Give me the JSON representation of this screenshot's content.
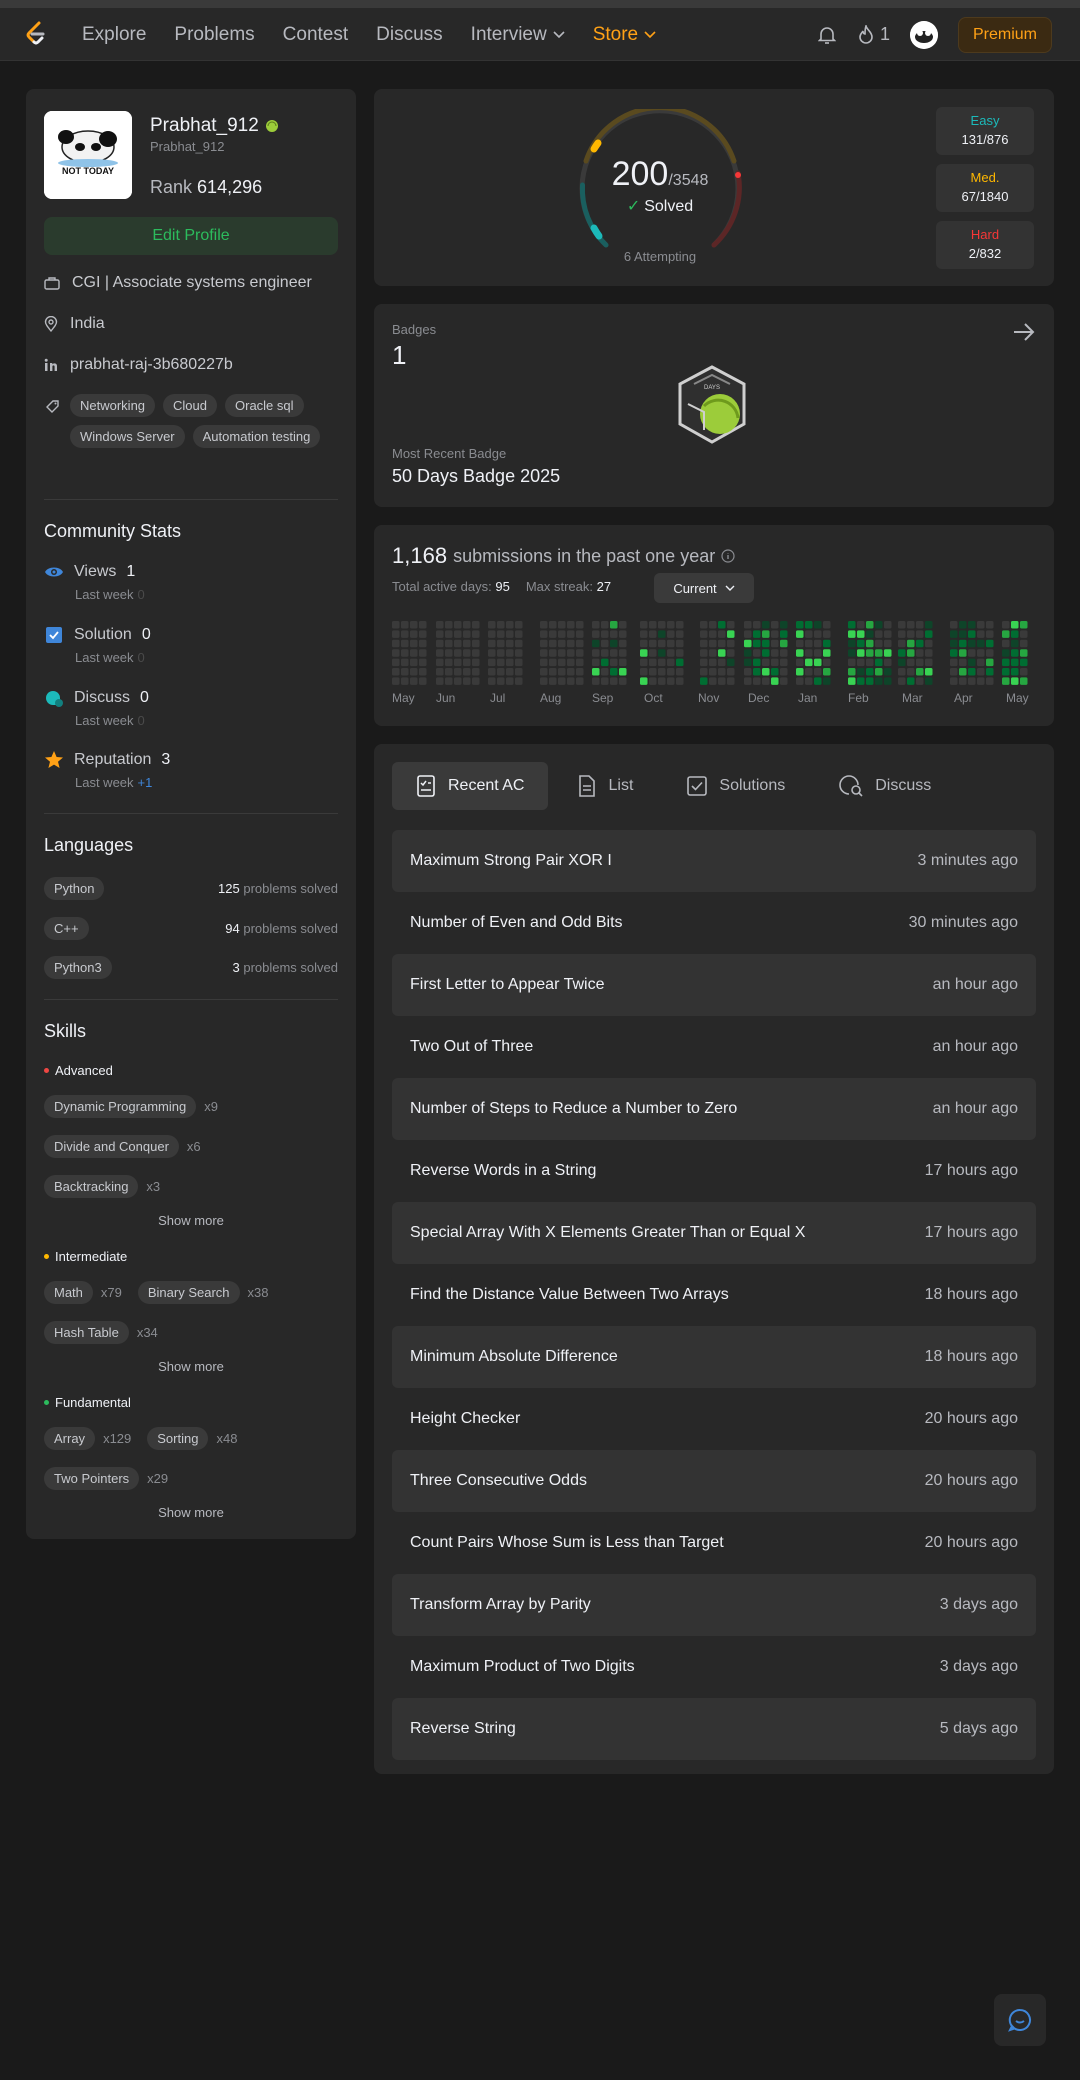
{
  "nav": {
    "links": [
      "Explore",
      "Problems",
      "Contest",
      "Discuss",
      "Interview",
      "Store"
    ],
    "streak": "1",
    "premium": "Premium"
  },
  "profile": {
    "name": "Prabhat_912",
    "username": "Prabhat_912",
    "rank_label": "Rank",
    "rank": "614,296",
    "avatar_text": "NOT TODAY",
    "edit": "Edit Profile",
    "company": "CGI | Associate systems engineer",
    "location": "India",
    "linkedin": "prabhat-raj-3b680227b",
    "tags": [
      "Networking",
      "Cloud",
      "Oracle sql",
      "Windows Server",
      "Automation testing"
    ]
  },
  "community": {
    "title": "Community Stats",
    "last_week": "Last week",
    "stats": [
      {
        "label": "Views",
        "value": "1",
        "delta": "0"
      },
      {
        "label": "Solution",
        "value": "0",
        "delta": "0"
      },
      {
        "label": "Discuss",
        "value": "0",
        "delta": "0"
      },
      {
        "label": "Reputation",
        "value": "3",
        "delta": "+1"
      }
    ]
  },
  "languages": {
    "title": "Languages",
    "suffix": "problems solved",
    "items": [
      {
        "name": "Python",
        "count": "125"
      },
      {
        "name": "C++",
        "count": "94"
      },
      {
        "name": "Python3",
        "count": "3"
      }
    ]
  },
  "skills": {
    "title": "Skills",
    "show_more": "Show more",
    "levels": [
      {
        "name": "Advanced",
        "color": "#ef4743",
        "items": [
          {
            "n": "Dynamic Programming",
            "c": "x9"
          },
          {
            "n": "Divide and Conquer",
            "c": "x6"
          },
          {
            "n": "Backtracking",
            "c": "x3"
          }
        ]
      },
      {
        "name": "Intermediate",
        "color": "#ffb800",
        "items": [
          {
            "n": "Math",
            "c": "x79"
          },
          {
            "n": "Binary Search",
            "c": "x38"
          },
          {
            "n": "Hash Table",
            "c": "x34"
          }
        ]
      },
      {
        "name": "Fundamental",
        "color": "#2cbb5d",
        "items": [
          {
            "n": "Array",
            "c": "x129"
          },
          {
            "n": "Sorting",
            "c": "x48"
          },
          {
            "n": "Two Pointers",
            "c": "x29"
          }
        ]
      }
    ]
  },
  "solved": {
    "count": "200",
    "total": "/3548",
    "label": "Solved",
    "attempting": "6 Attempting",
    "easy": {
      "label": "Easy",
      "value": "131/876",
      "color": "#1cbaba"
    },
    "medium": {
      "label": "Med.",
      "value": "67/1840",
      "color": "#ffb800"
    },
    "hard": {
      "label": "Hard",
      "value": "2/832",
      "color": "#f63737"
    }
  },
  "badges": {
    "label": "Badges",
    "count": "1",
    "badge_text": "DAYS",
    "recent_label": "Most Recent Badge",
    "recent_name": "50 Days Badge 2025"
  },
  "submissions": {
    "count": "1,168",
    "text": "submissions in the past one year",
    "active_label": "Total active days:",
    "active": "95",
    "streak_label": "Max streak:",
    "streak": "27",
    "period": "Current",
    "months": [
      "May",
      "Jun",
      "Jul",
      "Aug",
      "Sep",
      "Oct",
      "Nov",
      "Dec",
      "Jan",
      "Feb",
      "Mar",
      "Apr",
      "May"
    ]
  },
  "recent": {
    "tabs": [
      "Recent AC",
      "List",
      "Solutions",
      "Discuss"
    ],
    "items": [
      {
        "title": "Maximum Strong Pair XOR I",
        "time": "3 minutes ago"
      },
      {
        "title": "Number of Even and Odd Bits",
        "time": "30 minutes ago"
      },
      {
        "title": "First Letter to Appear Twice",
        "time": "an hour ago"
      },
      {
        "title": "Two Out of Three",
        "time": "an hour ago"
      },
      {
        "title": "Number of Steps to Reduce a Number to Zero",
        "time": "an hour ago"
      },
      {
        "title": "Reverse Words in a String",
        "time": "17 hours ago"
      },
      {
        "title": "Special Array With X Elements Greater Than or Equal X",
        "time": "17 hours ago"
      },
      {
        "title": "Find the Distance Value Between Two Arrays",
        "time": "18 hours ago"
      },
      {
        "title": "Minimum Absolute Difference",
        "time": "18 hours ago"
      },
      {
        "title": "Height Checker",
        "time": "20 hours ago"
      },
      {
        "title": "Three Consecutive Odds",
        "time": "20 hours ago"
      },
      {
        "title": "Count Pairs Whose Sum is Less than Target",
        "time": "20 hours ago"
      },
      {
        "title": "Transform Array by Parity",
        "time": "3 days ago"
      },
      {
        "title": "Maximum Product of Two Digits",
        "time": "3 days ago"
      },
      {
        "title": "Reverse String",
        "time": "5 days ago"
      }
    ]
  }
}
